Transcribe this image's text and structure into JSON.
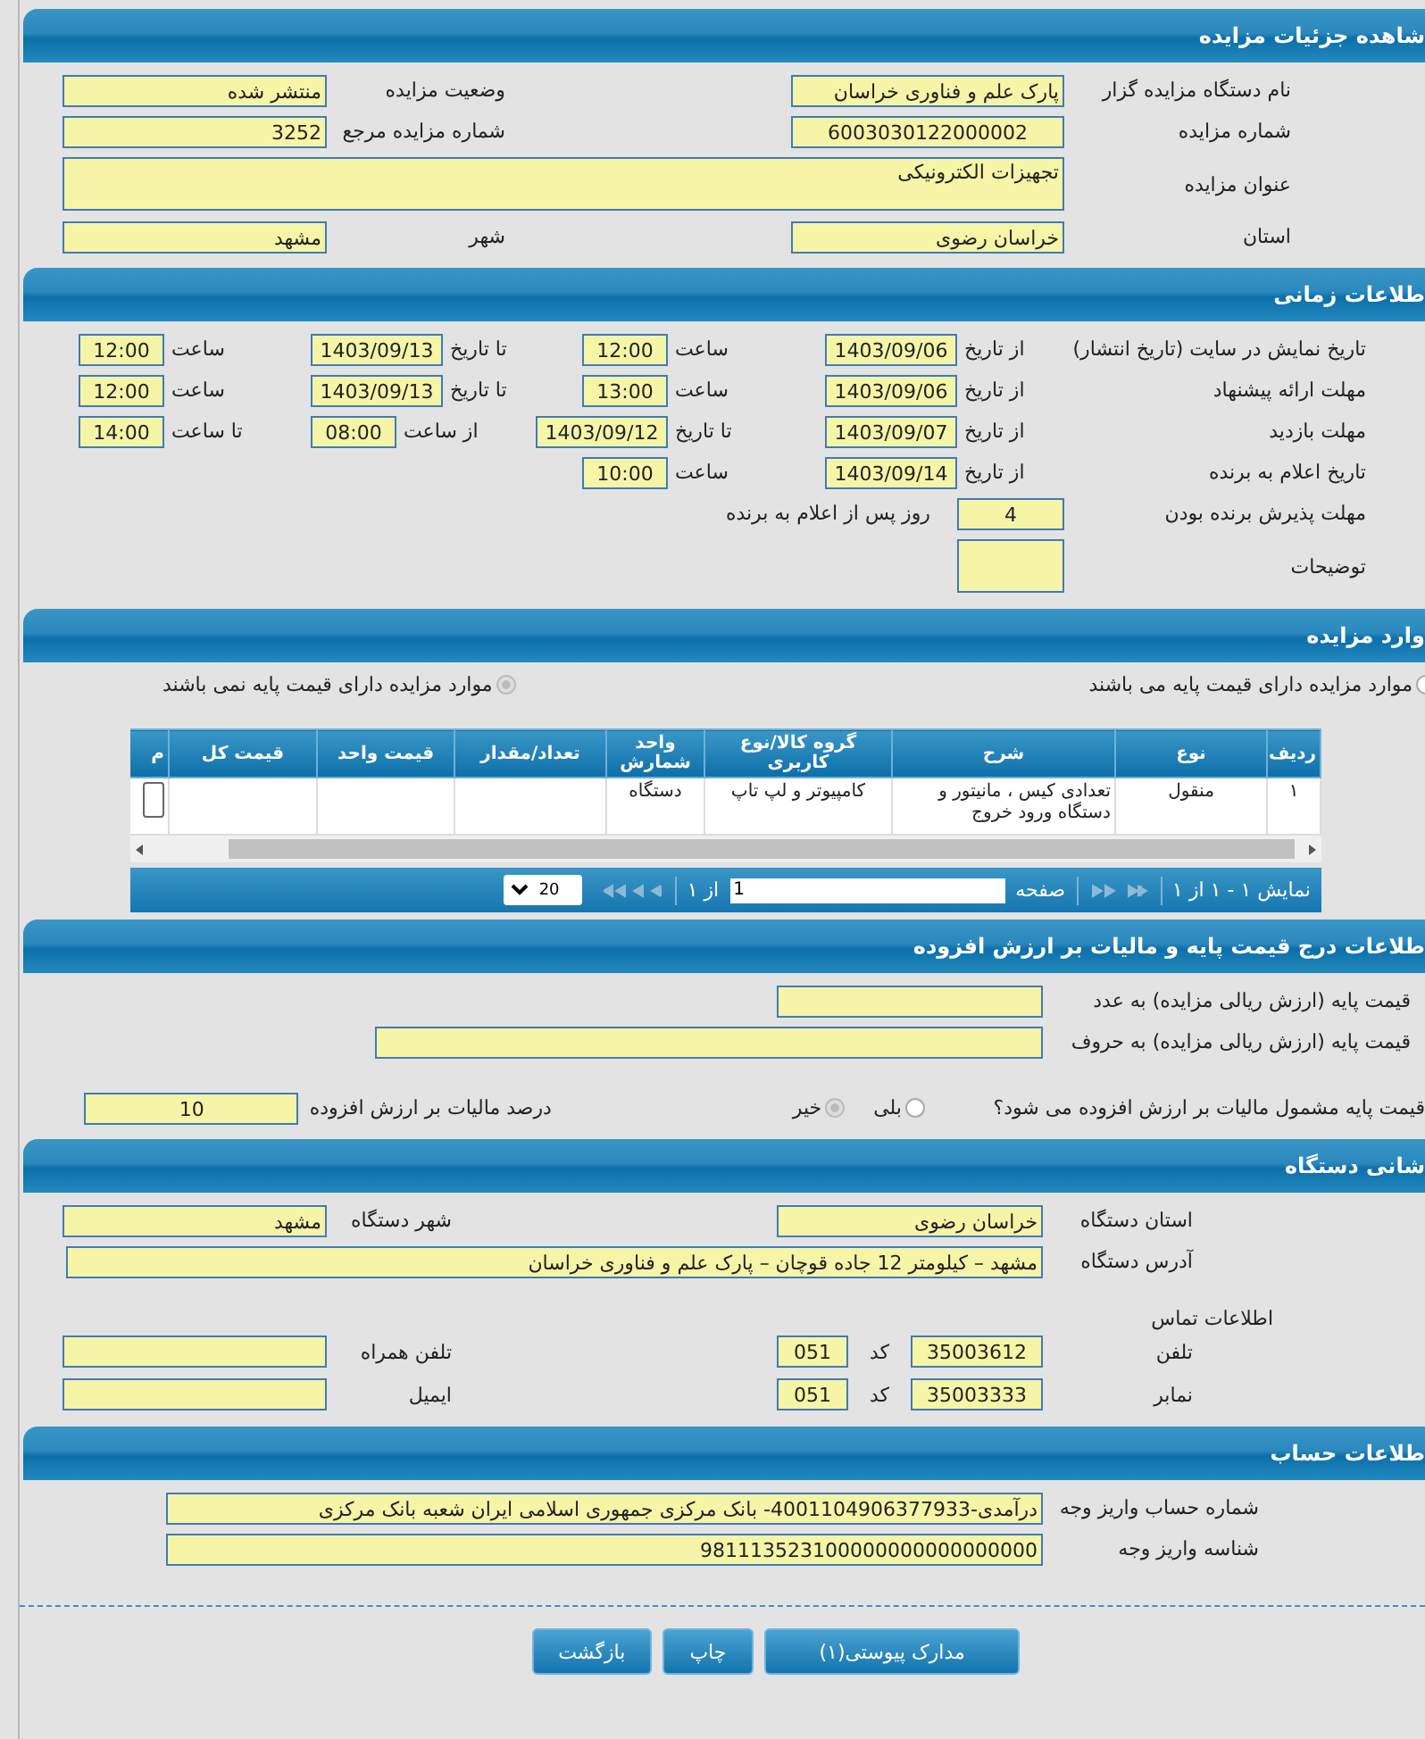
{
  "details": {
    "title": "شاهده جزئیات مزایده",
    "rows": [
      {
        "cells": [
          {
            "kind": "label",
            "text": "نام دستگاه مزایده گزار"
          },
          {
            "kind": "field",
            "value": "پارک علم و فناوری خراسان"
          },
          {
            "kind": "label",
            "text": "وضعیت مزایده"
          },
          {
            "kind": "field",
            "value": "منتشر شده"
          }
        ]
      },
      {
        "cells": [
          {
            "kind": "label",
            "text": "شماره مزایده"
          },
          {
            "kind": "number",
            "value": "6003030122000002"
          },
          {
            "kind": "label",
            "text": "شماره مزایده مرجع"
          },
          {
            "kind": "field",
            "value": "3252"
          }
        ]
      },
      {
        "cells": [
          {
            "kind": "label",
            "text": "عنوان مزایده"
          },
          {
            "kind": "area",
            "value": "تجهیزات الکترونیکی"
          }
        ]
      },
      {
        "cells": [
          {
            "kind": "label",
            "text": "استان"
          },
          {
            "kind": "field",
            "value": "خراسان رضوی"
          },
          {
            "kind": "label",
            "text": "شهر"
          },
          {
            "kind": "field",
            "value": "مشهد"
          }
        ]
      }
    ]
  },
  "timing": {
    "title": "طلاعات زمانی",
    "rows": [
      {
        "cells": [
          {
            "kind": "label",
            "text": "تاریخ نمایش در سایت (تاریخ انتشار)"
          },
          {
            "kind": "text",
            "text": "از تاریخ"
          },
          {
            "kind": "date",
            "value": "1403/09/06"
          },
          {
            "kind": "text",
            "text": "ساعت"
          },
          {
            "kind": "time",
            "value": "12:00"
          },
          {
            "kind": "text",
            "text": "تا تاریخ"
          },
          {
            "kind": "date",
            "value": "1403/09/13"
          },
          {
            "kind": "text",
            "text": "ساعت"
          },
          {
            "kind": "time",
            "value": "12:00"
          }
        ]
      },
      {
        "cells": [
          {
            "kind": "label",
            "text": "مهلت ارائه پیشنهاد"
          },
          {
            "kind": "text",
            "text": "از تاریخ"
          },
          {
            "kind": "date",
            "value": "1403/09/06"
          },
          {
            "kind": "text",
            "text": "ساعت"
          },
          {
            "kind": "time",
            "value": "13:00"
          },
          {
            "kind": "text",
            "text": "تا تاریخ"
          },
          {
            "kind": "date",
            "value": "1403/09/13"
          },
          {
            "kind": "text",
            "text": "ساعت"
          },
          {
            "kind": "time",
            "value": "12:00"
          }
        ]
      },
      {
        "cells": [
          {
            "kind": "label",
            "text": "مهلت بازدید"
          },
          {
            "kind": "text",
            "text": "از تاریخ"
          },
          {
            "kind": "date",
            "value": "1403/09/07"
          },
          {
            "kind": "text",
            "text": "تا تاریخ"
          },
          {
            "kind": "date",
            "value": "1403/09/12"
          },
          {
            "kind": "text",
            "text": "از ساعت"
          },
          {
            "kind": "time",
            "value": "08:00"
          },
          {
            "kind": "text",
            "text": "تا ساعت"
          },
          {
            "kind": "time",
            "value": "14:00"
          }
        ]
      },
      {
        "cells": [
          {
            "kind": "label",
            "text": "تاریخ اعلام به برنده"
          },
          {
            "kind": "text",
            "text": "از تاریخ"
          },
          {
            "kind": "date",
            "value": "1403/09/14"
          },
          {
            "kind": "text",
            "text": "ساعت"
          },
          {
            "kind": "time",
            "value": "10:00"
          }
        ]
      },
      {
        "cells": [
          {
            "kind": "label",
            "text": "مهلت پذیرش برنده بودن"
          },
          {
            "kind": "number",
            "value": "4"
          },
          {
            "kind": "text",
            "text": "روز پس از اعلام به برنده"
          }
        ]
      },
      {
        "cells": [
          {
            "kind": "label",
            "text": "توضیحات"
          },
          {
            "kind": "area"
          }
        ]
      }
    ]
  },
  "items": {
    "title": "وارد مزایده",
    "options": [
      {
        "label": "موارد مزایده دارای قیمت پایه می باشند",
        "selected": false
      },
      {
        "label": "موارد مزایده دارای قیمت پایه نمی باشند",
        "selected": true
      }
    ],
    "table": {
      "columns": [
        "ردیف",
        "نوع",
        "شرح",
        "گروه کالا/نوع کاربری",
        "واحد شمارش",
        "تعداد/مقدار",
        "قیمت واحد",
        "قیمت کل",
        "م"
      ],
      "rows": [
        {
          "cells": [
            "۱",
            "منقول",
            "تعدادی کیس ، مانیتور و دستگاه ورود خروج",
            "کامپیوتر و لپ تاپ",
            "دستگاه",
            "",
            "",
            "",
            ""
          ]
        }
      ]
    },
    "pager": {
      "summary": "نمایش ۱ - ۱ از ۱",
      "page_label": "صفحه",
      "page": "1",
      "of": "از ۱",
      "page_size": "20"
    }
  },
  "pricing": {
    "title": "طلاعات درج قیمت پایه و مالیات بر ارزش افزوده",
    "rows": [
      {
        "cells": [
          {
            "kind": "label",
            "text": "قیمت پایه (ارزش ریالی مزایده) به عدد"
          },
          {
            "kind": "field"
          }
        ]
      },
      {
        "cells": [
          {
            "kind": "label",
            "text": "قیمت پایه (ارزش ریالی مزایده) به حروف"
          },
          {
            "kind": "wide"
          }
        ]
      },
      {
        "cells": [
          {
            "kind": "label",
            "text": "قیمت پایه مشمول مالیات بر ارزش افزوده می شود؟"
          },
          {
            "kind": "radio",
            "text": "بلی",
            "selected": false
          },
          {
            "kind": "radio",
            "text": "خیر",
            "selected": true
          },
          {
            "kind": "label",
            "text": "درصد مالیات بر ارزش افزوده"
          },
          {
            "kind": "number",
            "value": "10"
          }
        ]
      }
    ]
  },
  "address": {
    "title": "شانی دستگاه",
    "rows": [
      {
        "cells": [
          {
            "kind": "label",
            "text": "استان دستگاه"
          },
          {
            "kind": "field",
            "value": "خراسان رضوی"
          },
          {
            "kind": "label",
            "text": "شهر دستگاه"
          },
          {
            "kind": "field",
            "value": "مشهد"
          }
        ]
      },
      {
        "cells": [
          {
            "kind": "label",
            "text": "آدرس دستگاه"
          },
          {
            "kind": "wide",
            "value": "مشهد – کیلومتر 12 جاده قوچان – پارک علم و فناوری خراسان"
          }
        ]
      },
      {
        "cells": [
          {
            "kind": "heading",
            "text": "اطلاعات تماس"
          }
        ]
      }
    ],
    "contact": [
      {
        "label": "تلفن",
        "number": "35003612",
        "code_label": "کد",
        "code": "051",
        "other_label": "تلفن همراه"
      },
      {
        "label": "نمابر",
        "number": "35003333",
        "code_label": "کد",
        "code": "051",
        "other_label": "ایمیل"
      }
    ]
  },
  "account": {
    "title": "طلاعات حساب",
    "rows": [
      {
        "cells": [
          {
            "kind": "label",
            "text": "شماره حساب واریز وجه"
          },
          {
            "kind": "wide",
            "value": "درآمدی-4001104906377933- بانک مرکزی جمهوری اسلامی ایران شعبه بانک مرکزی"
          }
        ]
      },
      {
        "cells": [
          {
            "kind": "label",
            "text": "شناسه واریز وجه"
          },
          {
            "kind": "wide",
            "value": "981113523100000000000000000"
          }
        ]
      }
    ]
  },
  "buttons": [
    "مدارک پیوستی(۱)",
    "چاپ",
    "بازگشت"
  ]
}
